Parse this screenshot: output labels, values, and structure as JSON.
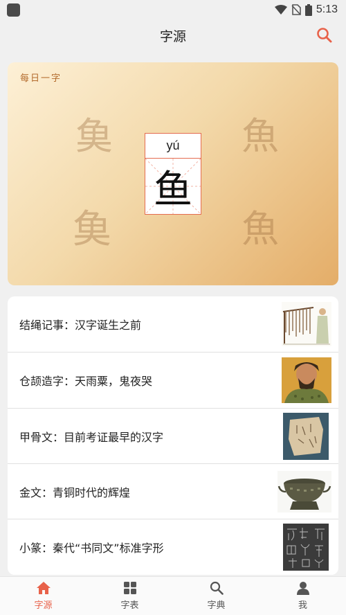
{
  "status": {
    "time": "5:13"
  },
  "header": {
    "title": "字源"
  },
  "daily": {
    "label": "每日一字",
    "pinyin": "yú",
    "character": "鱼",
    "ancient_forms": [
      "𩵋",
      "魚",
      "𩵋",
      "魚"
    ]
  },
  "topics": [
    {
      "text": "结绳记事：汉字诞生之前",
      "icon": "knotted-rope-image"
    },
    {
      "text": "仓颉造字：天雨粟，鬼夜哭",
      "icon": "cangjie-portrait-image"
    },
    {
      "text": "甲骨文：目前考证最早的汉字",
      "icon": "oracle-bone-image"
    },
    {
      "text": "金文：青铜时代的辉煌",
      "icon": "bronze-vessel-image"
    },
    {
      "text": "小篆：秦代“书同文”标准字形",
      "icon": "seal-script-rubbing-image"
    }
  ],
  "nav": [
    {
      "label": "字源",
      "icon": "home-icon",
      "active": true
    },
    {
      "label": "字表",
      "icon": "grid-icon",
      "active": false
    },
    {
      "label": "字典",
      "icon": "search-icon",
      "active": false
    },
    {
      "label": "我",
      "icon": "person-icon",
      "active": false
    }
  ],
  "colors": {
    "accent": "#e8624a",
    "grid": "#e46b50"
  }
}
